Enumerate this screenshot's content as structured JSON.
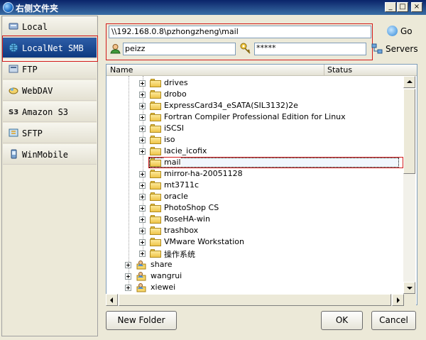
{
  "window": {
    "title": "右侧文件夹",
    "min_glyph": "_",
    "max_glyph": "□",
    "close_glyph": "×"
  },
  "nav": {
    "items": [
      {
        "label": "Local",
        "icon": "local-disk-icon"
      },
      {
        "label": "LocalNet SMB",
        "icon": "network-globe-icon",
        "active": true
      },
      {
        "label": "FTP",
        "icon": "ftp-icon"
      },
      {
        "label": "WebDAV",
        "icon": "webdav-icon"
      },
      {
        "label": "Amazon S3",
        "icon": "s3-icon"
      },
      {
        "label": "SFTP",
        "icon": "sftp-icon"
      },
      {
        "label": "WinMobile",
        "icon": "mobile-device-icon"
      }
    ]
  },
  "connection": {
    "path": "\\\\192.168.0.8\\pzhongzheng\\mail",
    "go_label": "Go",
    "username": "peizz",
    "password": "*****",
    "servers_label": "Servers"
  },
  "list": {
    "columns": [
      "Name",
      "Status"
    ],
    "folders": [
      "drives",
      "drobo",
      "ExpressCard34_eSATA(SIL3132)2e",
      "Fortran Compiler Professional Edition for Linux",
      "iSCSI",
      "iso",
      "lacie_icofix",
      "mail",
      "mirror-ha-20051128",
      "mt3711c",
      "oracle",
      "PhotoShop CS",
      "RoseHA-win",
      "trashbox",
      "VMware Workstation",
      "操作系统"
    ],
    "users": [
      "share",
      "wangrui",
      "xiewei"
    ],
    "selected": "mail"
  },
  "buttons": {
    "new_folder": "New Folder",
    "ok": "OK",
    "cancel": "Cancel"
  },
  "colors": {
    "highlight": "#d21b1b",
    "title_bar": "#0a246a",
    "active_nav": "#0e3a80"
  }
}
